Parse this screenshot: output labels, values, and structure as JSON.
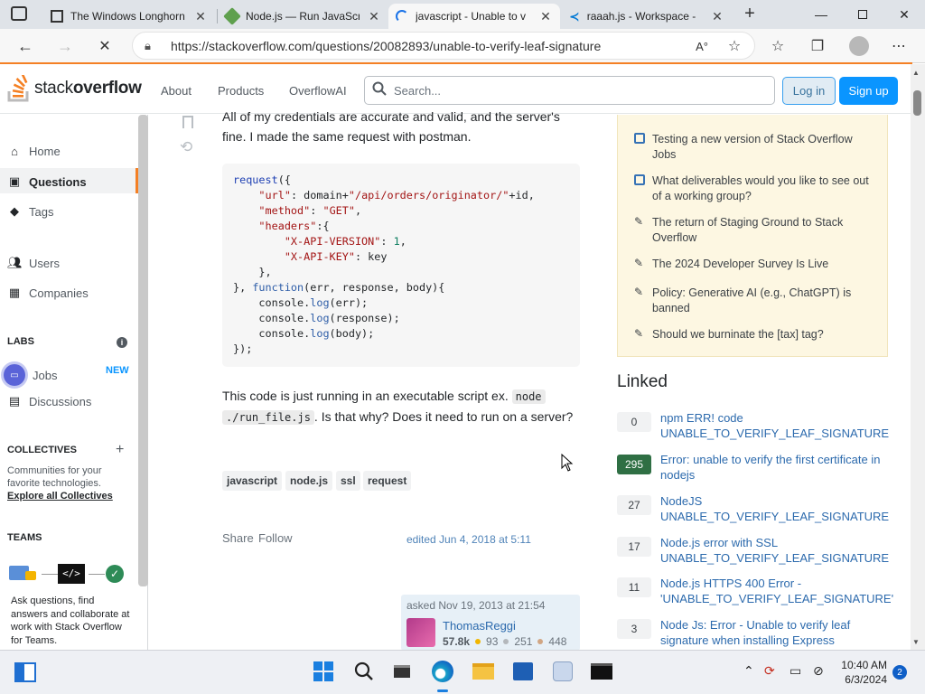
{
  "browser": {
    "tabs": [
      {
        "title": "The Windows Longhorn"
      },
      {
        "title": "Node.js — Run JavaScri"
      },
      {
        "title": "javascript - Unable to v"
      },
      {
        "title": "raaah.js - Workspace -"
      }
    ],
    "url": "https://stackoverflow.com/questions/20082893/unable-to-verify-leaf-signature"
  },
  "so_header": {
    "logo_text_light": "stack",
    "logo_text_bold": "overflow",
    "nav": [
      "About",
      "Products",
      "OverflowAI"
    ],
    "search_placeholder": "Search...",
    "login": "Log in",
    "signup": "Sign up"
  },
  "leftnav": {
    "home": "Home",
    "questions": "Questions",
    "tags": "Tags",
    "users": "Users",
    "companies": "Companies",
    "labs_title": "LABS",
    "jobs": "Jobs",
    "jobs_badge": "NEW",
    "discussions": "Discussions",
    "collectives_title": "COLLECTIVES",
    "collectives_desc_1": "Communities for your",
    "collectives_desc_2": "favorite technologies.",
    "collectives_link": "Explore all Collectives",
    "teams_title": "TEAMS",
    "teams_desc": [
      "Ask questions, find",
      "answers and collaborate at",
      "work with Stack Overflow",
      "for Teams."
    ]
  },
  "question": {
    "para1_line1": "All of my credentials are accurate and valid, and the server's",
    "para1_line2": "fine. I made the same request with postman.",
    "para2_a": "This code is just running in an executable script ex.",
    "para2_code1": "node",
    "para2_code2": "./run_file.js",
    "para2_b": ". Is that why? Does it need to run on a",
    "para2_c": "server?",
    "tags": [
      "javascript",
      "node.js",
      "ssl",
      "request"
    ],
    "share": "Share",
    "follow": "Follow",
    "edited": "edited Jun 4, 2018 at 5:11",
    "asked": "asked Nov 19, 2013 at 21:54",
    "user_name": "ThomasReggi",
    "user_rep": "57.8k",
    "gold": "93",
    "silver": "251",
    "bronze": "448"
  },
  "blog": {
    "items": [
      "Testing a new version of Stack Overflow Jobs",
      "What deliverables would you like to see out of a working group?",
      "The return of Staging Ground to Stack Overflow",
      "The 2024 Developer Survey Is Live",
      "Policy: Generative AI (e.g., ChatGPT) is banned",
      "Should we burninate the [tax] tag?"
    ]
  },
  "linked": {
    "title": "Linked",
    "items": [
      {
        "score": "0",
        "text": "npm ERR! code UNABLE_TO_VERIFY_LEAF_SIGNATURE"
      },
      {
        "score": "295",
        "text": "Error: unable to verify the first certificate in nodejs"
      },
      {
        "score": "27",
        "text": "NodeJS UNABLE_TO_VERIFY_LEAF_SIGNATURE"
      },
      {
        "score": "17",
        "text": "Node.js error with SSL UNABLE_TO_VERIFY_LEAF_SIGNATURE"
      },
      {
        "score": "11",
        "text": "Node.js HTTPS 400 Error - 'UNABLE_TO_VERIFY_LEAF_SIGNATURE'"
      },
      {
        "score": "3",
        "text": "Node Js: Error - Unable to verify leaf signature when installing Express"
      }
    ]
  },
  "taskbar": {
    "time": "10:40 AM",
    "date": "6/3/2024",
    "notifications": "2"
  },
  "colors": {
    "accent": "#f48024",
    "link": "#2c6aad",
    "accepted": "#2f6f44",
    "primary_button": "#0a95ff"
  }
}
